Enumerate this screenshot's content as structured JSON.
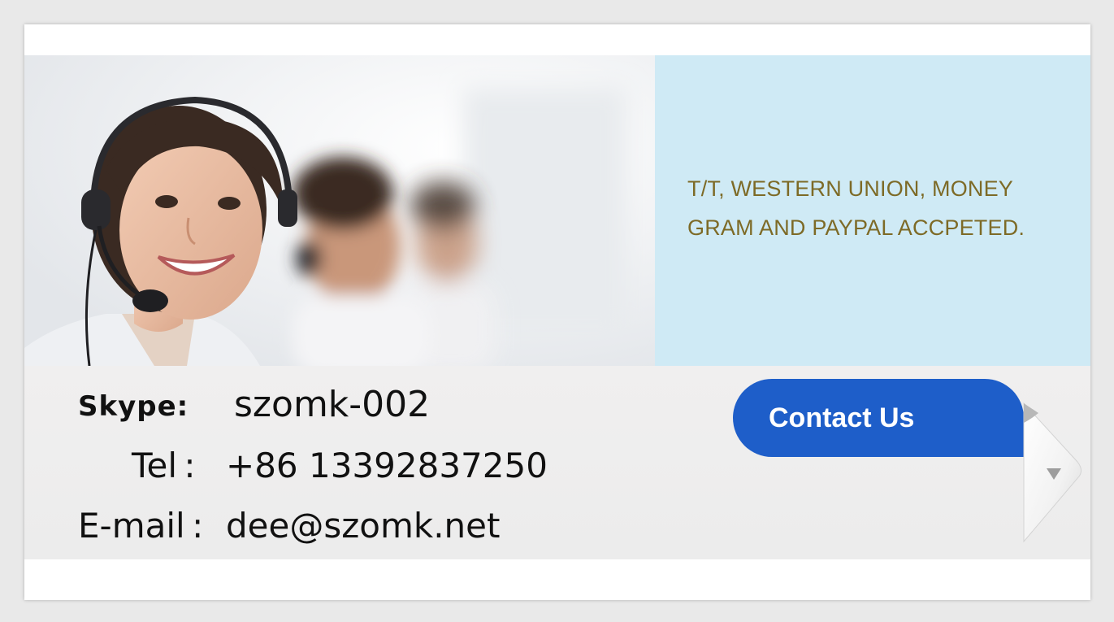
{
  "banner": {
    "payment_line1": "T/T, WESTERN UNION, MONEY",
    "payment_line2": "GRAM AND PAYPAL ACCPETED."
  },
  "contact": {
    "skype_label": "Skype:",
    "skype_value": "szomk-002",
    "tel_label": "Tel :",
    "tel_value": "+86 13392837250",
    "email_label": "E-mail :",
    "email_value": "dee@szomk.net",
    "button_label": "Contact Us"
  },
  "colors": {
    "button": "#1e5ec9",
    "info_panel": "#cfeaf5",
    "payment_text": "#7d6a26"
  },
  "icons": {
    "fold_arrow": "triangle-down-icon",
    "support_photo": "headset-agent-photo"
  }
}
